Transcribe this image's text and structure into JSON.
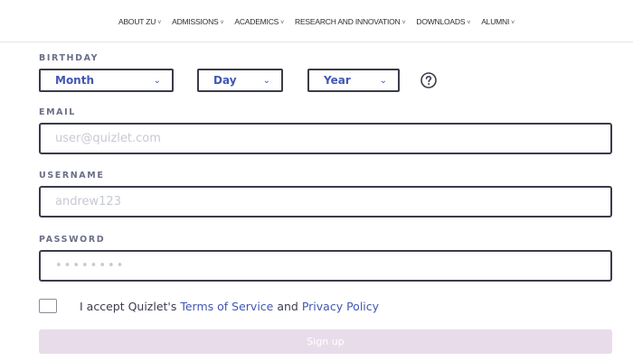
{
  "nav": {
    "items": [
      {
        "label": "ABOUT ZU"
      },
      {
        "label": "ADMISSIONS"
      },
      {
        "label": "ACADEMICS"
      },
      {
        "label": "RESEARCH AND INNOVATION"
      },
      {
        "label": "DOWNLOADS"
      },
      {
        "label": "ALUMNI"
      }
    ],
    "chevron": "˅"
  },
  "form": {
    "birthday": {
      "label": "BIRTHDAY",
      "month": "Month",
      "day": "Day",
      "year": "Year",
      "chevron": "⌄"
    },
    "email": {
      "label": "EMAIL",
      "placeholder": "user@quizlet.com"
    },
    "username": {
      "label": "USERNAME",
      "placeholder": "andrew123"
    },
    "password": {
      "label": "PASSWORD",
      "placeholder": "••••••••"
    },
    "terms": {
      "prefix": "I accept Quizlet's ",
      "tos": "Terms of Service",
      "and": " and ",
      "privacy": "Privacy Policy"
    },
    "signup_label": "Sign up"
  },
  "colors": {
    "accent": "#4257b2",
    "label": "#6b6f87",
    "button_bg": "#e9dcea",
    "border": "#3a3c4a"
  },
  "icons": {
    "help": "question-circle-icon",
    "chevron": "chevron-down-icon"
  }
}
